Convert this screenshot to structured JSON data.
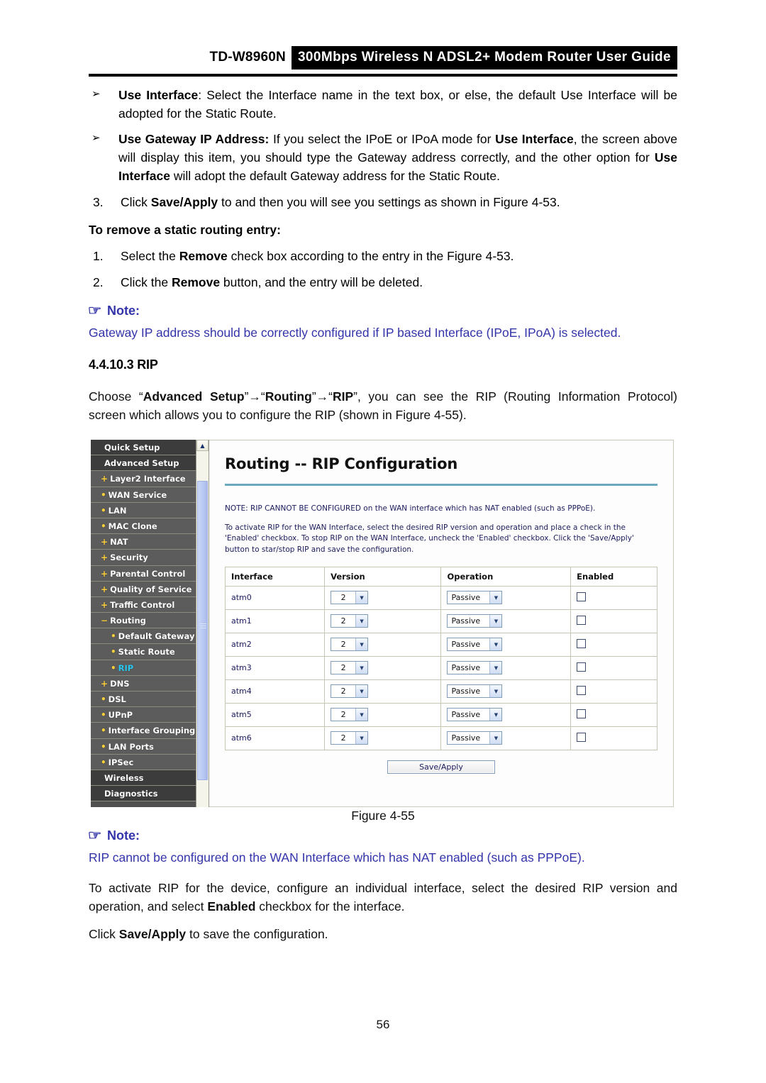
{
  "header": {
    "model": "TD-W8960N",
    "banner": "300Mbps Wireless N ADSL2+ Modem Router User Guide"
  },
  "bullets": [
    {
      "marker": "➢",
      "lead": "Use Interface",
      "text": ": Select the Interface name in the text box, or else, the default Use Interface will be adopted for the Static Route."
    },
    {
      "marker": "➢",
      "lead": "Use Gateway IP Address:",
      "text_1": "  If you select the IPoE or IPoA mode for ",
      "bold_1": "Use Interface",
      "text_2": ", the screen above will display this item, you should type the Gateway address correctly, and the other option for ",
      "bold_2": "Use Interface",
      "text_3": " will adopt the default Gateway address for the Static Route."
    }
  ],
  "step3": {
    "num": "3.",
    "text_1": "Click ",
    "bold": "Save/Apply",
    "text_2": " to and then you will see you settings as shown in Figure 4-53."
  },
  "remove_heading": "To remove a static routing entry:",
  "remove_steps": [
    {
      "num": "1.",
      "text_1": "Select the ",
      "bold": "Remove",
      "text_2": " check box according to the entry in the Figure 4-53."
    },
    {
      "num": "2.",
      "text_1": "Click the ",
      "bold": "Remove",
      "text_2": " button, and the entry will be deleted."
    }
  ],
  "note_top": {
    "icon": "☞",
    "title": "Note:",
    "text": "Gateway IP address should be correctly configured if IP based Interface (IPoE, IPoA) is selected."
  },
  "section": {
    "heading": "4.4.10.3 RIP",
    "intro_1": "Choose “",
    "intro_b1": "Advanced Setup",
    "intro_2": "”→“",
    "intro_b2": "Routing",
    "intro_3": "”→“",
    "intro_b3": "RIP",
    "intro_4": "”, you can see the RIP (Routing Information Protocol) screen which allows you to configure the RIP (shown in Figure 4-55)."
  },
  "screenshot": {
    "sidebar": [
      {
        "label": "Quick Setup",
        "level": 0,
        "prefix": "",
        "active": false
      },
      {
        "label": "Advanced Setup",
        "level": 0,
        "prefix": "",
        "active": false
      },
      {
        "label": "Layer2 Interface",
        "level": 1,
        "prefix": "+",
        "active": false
      },
      {
        "label": "WAN Service",
        "level": 1,
        "prefix": "•",
        "active": false
      },
      {
        "label": "LAN",
        "level": 1,
        "prefix": "•",
        "active": false
      },
      {
        "label": "MAC Clone",
        "level": 1,
        "prefix": "•",
        "active": false
      },
      {
        "label": "NAT",
        "level": 1,
        "prefix": "+",
        "active": false
      },
      {
        "label": "Security",
        "level": 1,
        "prefix": "+",
        "active": false
      },
      {
        "label": "Parental Control",
        "level": 1,
        "prefix": "+",
        "active": false
      },
      {
        "label": "Quality of Service",
        "level": 1,
        "prefix": "+",
        "active": false
      },
      {
        "label": "Traffic Control",
        "level": 1,
        "prefix": "+",
        "active": false
      },
      {
        "label": "Routing",
        "level": 1,
        "prefix": "−",
        "active": false
      },
      {
        "label": "Default Gateway",
        "level": 2,
        "prefix": "•",
        "active": false
      },
      {
        "label": "Static Route",
        "level": 2,
        "prefix": "•",
        "active": false
      },
      {
        "label": "RIP",
        "level": 2,
        "prefix": "•",
        "active": true
      },
      {
        "label": "DNS",
        "level": 1,
        "prefix": "+",
        "active": false
      },
      {
        "label": "DSL",
        "level": 1,
        "prefix": "•",
        "active": false
      },
      {
        "label": "UPnP",
        "level": 1,
        "prefix": "•",
        "active": false
      },
      {
        "label": "Interface Grouping",
        "level": 1,
        "prefix": "•",
        "active": false
      },
      {
        "label": "LAN Ports",
        "level": 1,
        "prefix": "•",
        "active": false
      },
      {
        "label": "IPSec",
        "level": 1,
        "prefix": "•",
        "active": false
      },
      {
        "label": "Wireless",
        "level": 0,
        "prefix": "",
        "active": false
      },
      {
        "label": "Diagnostics",
        "level": 0,
        "prefix": "",
        "active": false
      }
    ],
    "panel": {
      "title": "Routing -- RIP Configuration",
      "note": "NOTE: RIP CANNOT BE CONFIGURED on the WAN interface which has NAT enabled (such as PPPoE).",
      "description": "To activate RIP for the WAN Interface, select the desired RIP version and operation and place a check in the 'Enabled' checkbox. To stop RIP on the WAN Interface, uncheck the 'Enabled' checkbox. Click the 'Save/Apply' button to star/stop RIP and save the configuration.",
      "columns": [
        "Interface",
        "Version",
        "Operation",
        "Enabled"
      ],
      "rows": [
        {
          "interface": "atm0",
          "version": "2",
          "operation": "Passive",
          "enabled": false
        },
        {
          "interface": "atm1",
          "version": "2",
          "operation": "Passive",
          "enabled": false
        },
        {
          "interface": "atm2",
          "version": "2",
          "operation": "Passive",
          "enabled": false
        },
        {
          "interface": "atm3",
          "version": "2",
          "operation": "Passive",
          "enabled": false
        },
        {
          "interface": "atm4",
          "version": "2",
          "operation": "Passive",
          "enabled": false
        },
        {
          "interface": "atm5",
          "version": "2",
          "operation": "Passive",
          "enabled": false
        },
        {
          "interface": "atm6",
          "version": "2",
          "operation": "Passive",
          "enabled": false
        }
      ],
      "save_button": "Save/Apply"
    }
  },
  "figure_caption": "Figure 4-55",
  "note_bottom": {
    "icon": "☞",
    "title": "Note:",
    "text": "RIP cannot be configured on the WAN Interface which has NAT enabled (such as PPPoE)."
  },
  "closing": {
    "p1_text_1": "To activate RIP for the device, configure an individual interface, select the desired RIP version and operation, and select ",
    "p1_bold": "Enabled",
    "p1_text_2": " checkbox for the interface.",
    "p2_text_1": "Click ",
    "p2_bold": "Save/Apply",
    "p2_text_2": " to save the configuration."
  },
  "page_number": "56",
  "colors": {
    "note_blue": "#3333aa",
    "sidebar_active": "#29c8f0",
    "sidebar_prefix": "#ffd23b",
    "panel_rule": "#6aa8c0"
  }
}
